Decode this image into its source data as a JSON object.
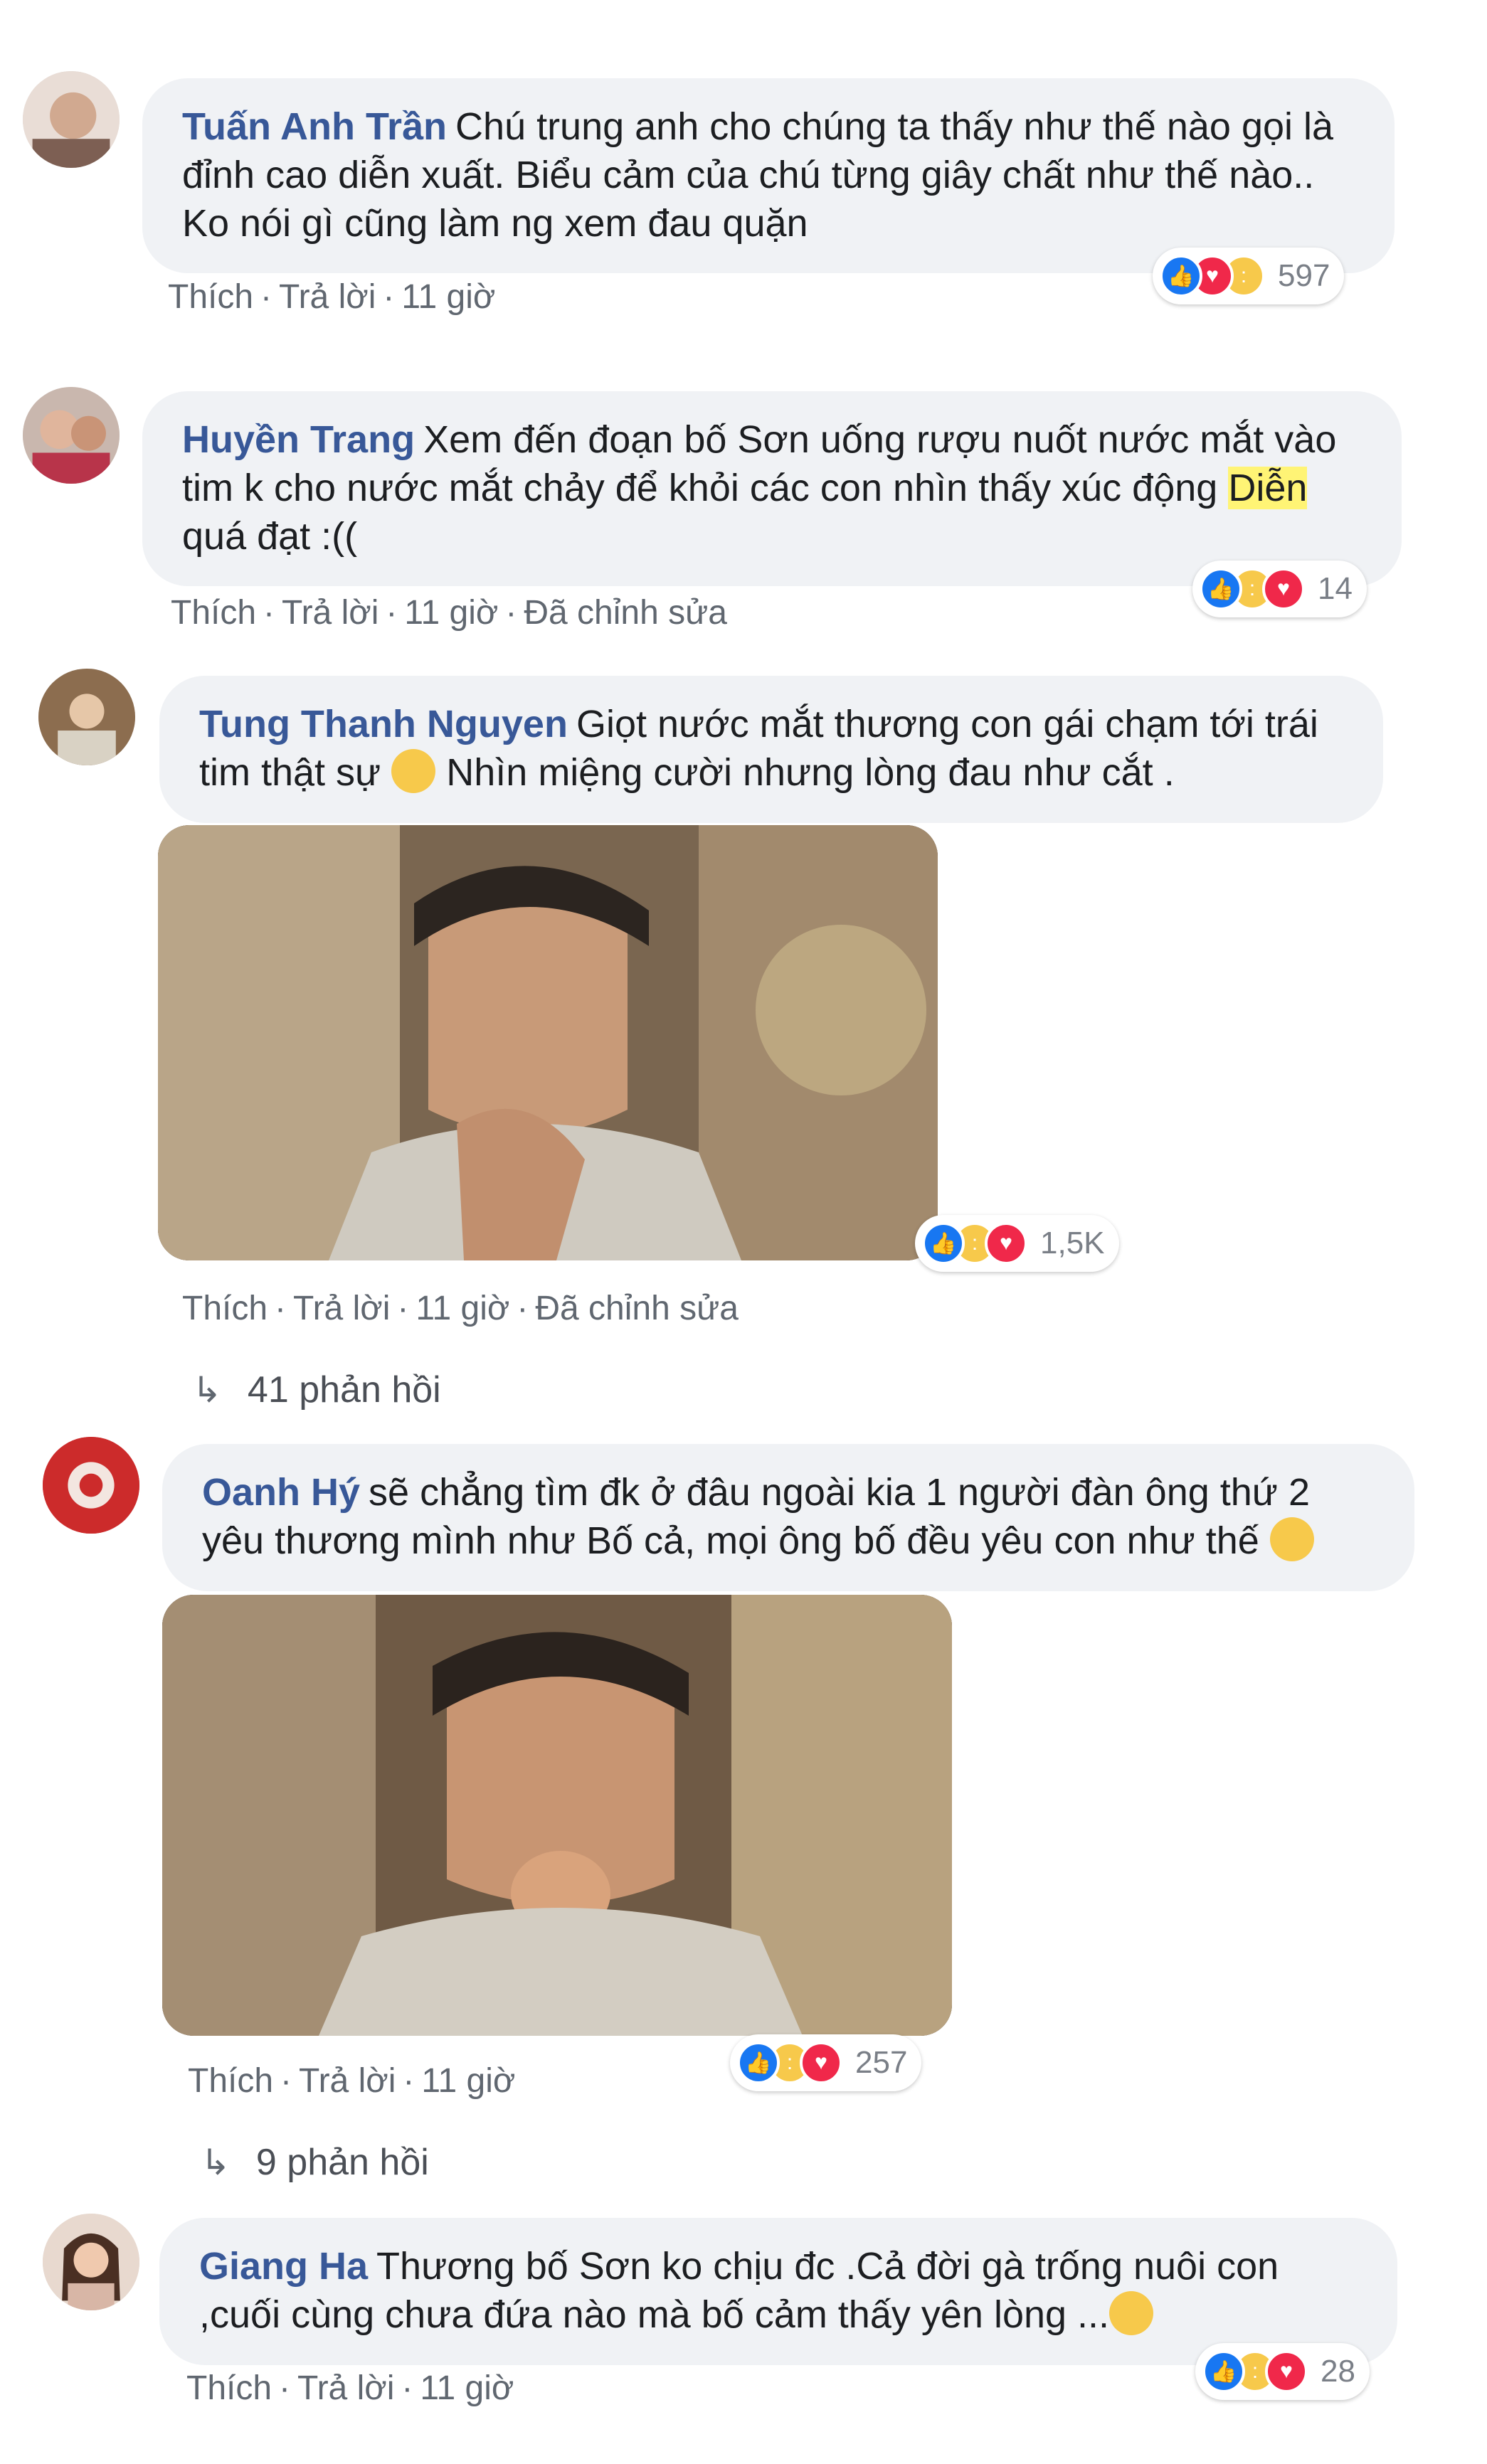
{
  "comments": [
    {
      "author": "Tuấn Anh Trần",
      "text": "Chú trung anh cho chúng ta thấy như thế nào gọi là đỉnh cao diễn xuất. Biểu cảm của chú từng giây chất như thế nào.. Ko nói gì cũng làm ng xem đau quặn",
      "actions": {
        "like": "Thích",
        "reply": "Trả lời",
        "time": "11 giờ"
      },
      "reaction_count": "597",
      "reactions": [
        "like-icon",
        "love-icon",
        "sad-icon"
      ]
    },
    {
      "author": "Huyền Trang",
      "text_main": "Xem đến đoạn bố Sơn uống rượu nuốt nước mắt vào tim k cho nước mắt chảy để khỏi các con nhìn thấy xúc động",
      "text_highlight": "Diễn",
      "text_end": "quá đạt :((",
      "actions": {
        "like": "Thích",
        "reply": "Trả lời",
        "time": "11 giờ",
        "edited": "Đã chỉnh sửa"
      },
      "reaction_count": "14",
      "reactions": [
        "like-icon",
        "haha-icon",
        "love-icon"
      ]
    },
    {
      "author": "Tung Thanh Nguyen",
      "text_a": "Giọt nước mắt thương con gái chạm tới trái tim thật sự",
      "text_b": "Nhìn miệng cười nhưng lòng đau như cắt .",
      "emoji": "disappointed-emoji",
      "actions": {
        "like": "Thích",
        "reply": "Trả lời",
        "time": "11 giờ",
        "edited": "Đã chỉnh sửa"
      },
      "reaction_count": "1,5K",
      "reactions": [
        "like-icon",
        "sad-icon",
        "love-icon"
      ],
      "replies": "41 phản hồi"
    },
    {
      "author": "Oanh Hý",
      "text": "sẽ chẳng tìm đk ở đâu ngoài kia 1 người đàn ông thứ 2 yêu thương mình như Bố cả, mọi ông bố đều yêu con như thế",
      "emoji": "frowning-emoji",
      "actions": {
        "like": "Thích",
        "reply": "Trả lời",
        "time": "11 giờ"
      },
      "reaction_count": "257",
      "reactions": [
        "like-icon",
        "sad-icon",
        "love-icon"
      ],
      "replies": "9 phản hồi"
    },
    {
      "author": "Giang Ha",
      "text": "Thương bố Sơn ko chịu đc .Cả đời gà trống nuôi con ,cuối cùng chưa đứa nào mà bố cảm thấy yên lòng ...",
      "emoji": "crying-emoji",
      "actions": {
        "like": "Thích",
        "reply": "Trả lời",
        "time": "11 giờ"
      },
      "reaction_count": "28",
      "reactions": [
        "like-icon",
        "sad-icon",
        "love-icon"
      ]
    }
  ],
  "colors": {
    "author": "#385898",
    "bubble": "#f0f2f5",
    "meta": "#606770",
    "like": "#1877f2",
    "love": "#f0284a",
    "sad": "#f7c94b"
  }
}
